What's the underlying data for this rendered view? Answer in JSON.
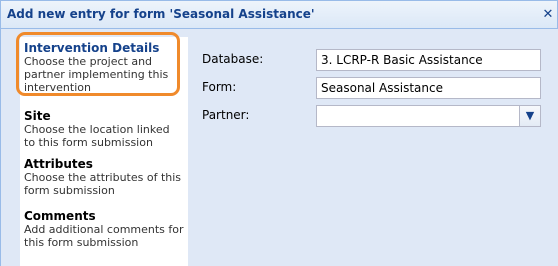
{
  "dialog": {
    "title": "Add new entry for form 'Seasonal Assistance'",
    "close_icon": "close-icon"
  },
  "sidebar": {
    "items": [
      {
        "title": "Intervention Details",
        "description": "Choose the project and partner implementing this intervention",
        "selected": true
      },
      {
        "title": "Site",
        "description": "Choose the location linked to this form submission",
        "selected": false
      },
      {
        "title": "Attributes",
        "description": "Choose the attributes of this form submission",
        "selected": false
      },
      {
        "title": "Comments",
        "description": "Add additional comments for this form submission",
        "selected": false
      }
    ]
  },
  "form": {
    "database_label": "Database:",
    "database_value": "3. LCRP-R Basic Assistance",
    "form_label": "Form:",
    "form_value": "Seasonal Assistance",
    "partner_label": "Partner:",
    "partner_value": "",
    "partner_dropdown_icon": "chevron-down-icon"
  },
  "colors": {
    "highlight": "#f08a2b",
    "title_text": "#15428b",
    "panel_bg": "#dfe8f6"
  }
}
